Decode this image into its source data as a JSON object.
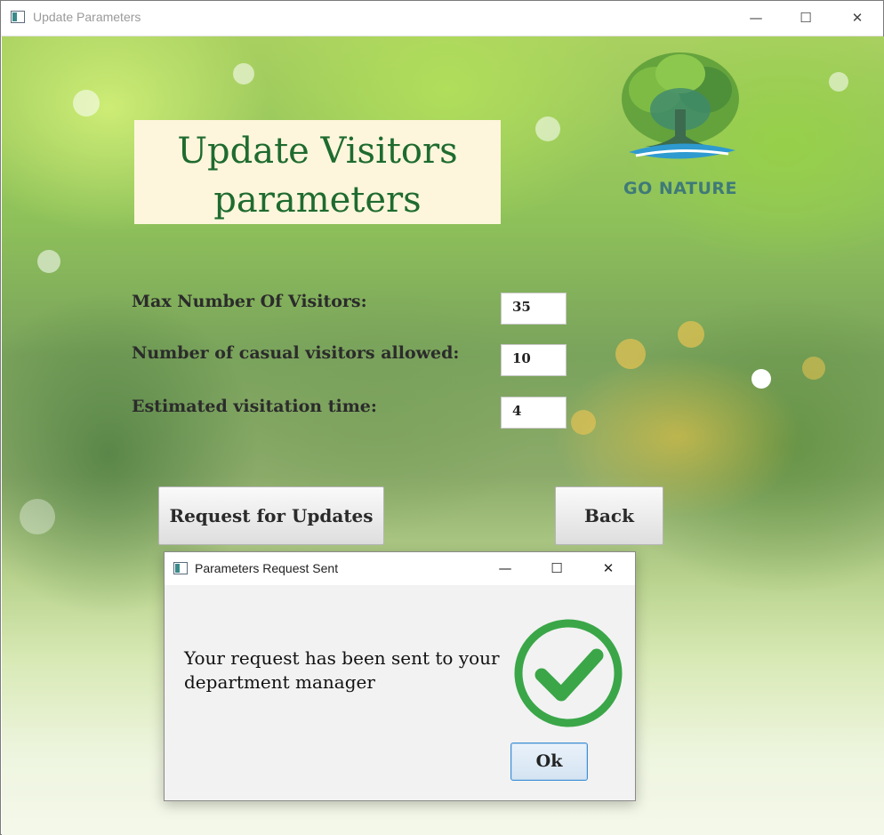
{
  "window": {
    "title": "Update Parameters",
    "controls": {
      "minimize": "—",
      "maximize": "☐",
      "close": "✕"
    }
  },
  "header": {
    "title_line1": "Update Visitors",
    "title_line2": "parameters"
  },
  "logo": {
    "text": "GO NATURE",
    "icon": "tree-logo-icon"
  },
  "form": {
    "fields": [
      {
        "label": "Max Number Of Visitors:",
        "value": "35"
      },
      {
        "label": "Number of casual visitors allowed:",
        "value": "10"
      },
      {
        "label": "Estimated visitation time:",
        "value": "4"
      }
    ]
  },
  "buttons": {
    "request_label": "Request for Updates",
    "back_label": "Back"
  },
  "dialog": {
    "title": "Parameters Request Sent",
    "controls": {
      "minimize": "—",
      "maximize": "☐",
      "close": "✕"
    },
    "message": "Your request has been sent to your department manager",
    "icon": "checkmark-icon",
    "ok_label": "Ok"
  },
  "colors": {
    "header_text": "#1f6b2f",
    "header_bg": "#fdf6dc",
    "check_green": "#3aa648"
  }
}
